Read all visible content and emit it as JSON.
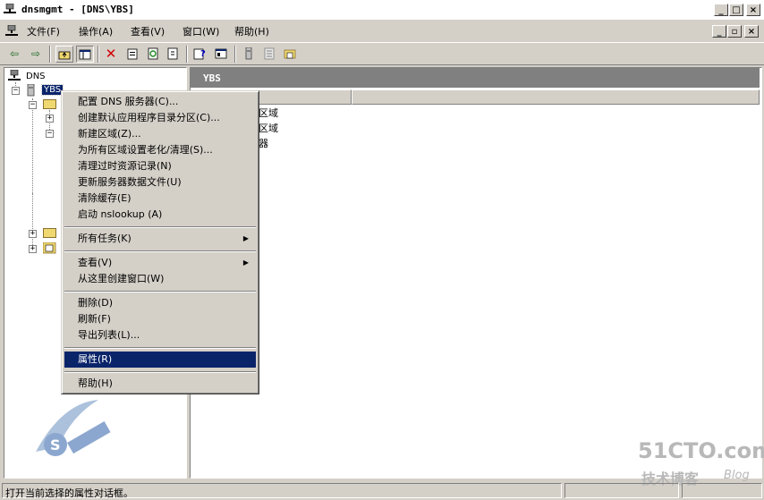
{
  "window": {
    "title": "dnsmgmt - [DNS\\YBS]"
  },
  "menubar": {
    "items": [
      "文件(F)",
      "操作(A)",
      "查看(V)",
      "窗口(W)",
      "帮助(H)"
    ]
  },
  "tree": {
    "root": "DNS",
    "server": "YBS"
  },
  "right_pane": {
    "header": "YBS",
    "items": [
      "区域",
      "区域",
      "器"
    ]
  },
  "context_menu": {
    "group1": [
      "配置 DNS 服务器(C)...",
      "创建默认应用程序目录分区(C)...",
      "新建区域(Z)...",
      "为所有区域设置老化/清理(S)...",
      "清理过时资源记录(N)",
      "更新服务器数据文件(U)",
      "清除缓存(E)",
      "启动 nslookup (A)"
    ],
    "all_tasks": "所有任务(K)",
    "view": "查看(V)",
    "new_window": "从这里创建窗口(W)",
    "group4": [
      "删除(D)",
      "刷新(F)",
      "导出列表(L)..."
    ],
    "properties": "属性(R)",
    "help": "帮助(H)"
  },
  "status": {
    "text": "打开当前选择的属性对话框。"
  },
  "watermarks": {
    "site": "51CTO.com",
    "sub": "技术博客",
    "blog": "Blog"
  },
  "colors": {
    "selection": "#0a246a",
    "face": "#d4d0c8",
    "header": "#808080"
  }
}
